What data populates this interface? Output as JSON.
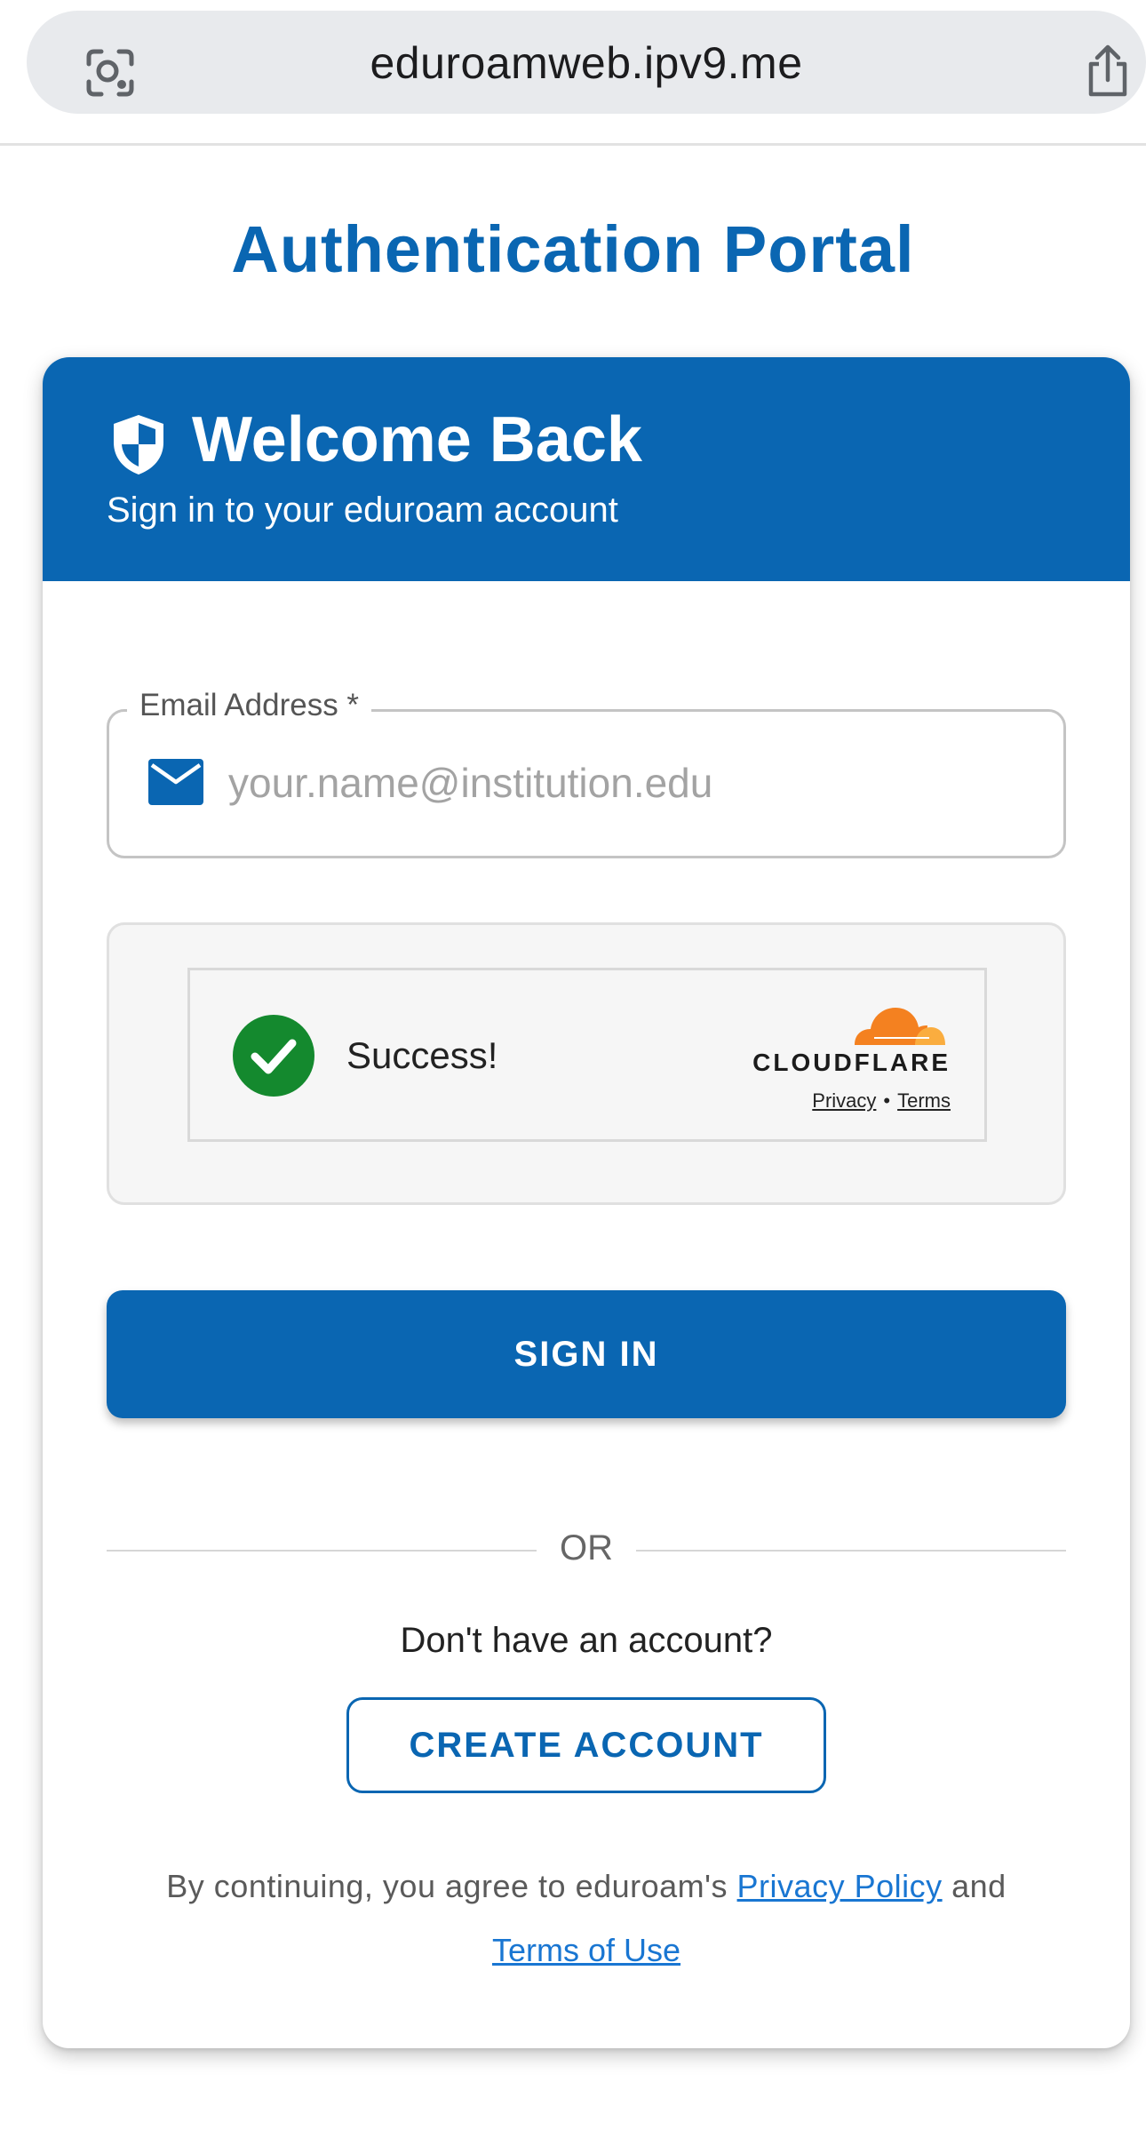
{
  "browser": {
    "url": "eduroamweb.ipv9.me",
    "icons": {
      "left": "visual-search-icon",
      "right": "share-icon"
    }
  },
  "page": {
    "title": "Authentication Portal"
  },
  "card": {
    "header": {
      "title": "Welcome Back",
      "subtitle": "Sign in to your eduroam account",
      "icon": "shield-icon"
    },
    "email": {
      "label": "Email Address *",
      "placeholder": "your.name@institution.edu",
      "value": "",
      "icon": "mail-icon"
    },
    "captcha": {
      "status": "Success!",
      "brand": "CLOUDFLARE",
      "privacy": "Privacy",
      "separator": "•",
      "terms": "Terms",
      "icon": "check-circle-icon"
    },
    "sign_in_label": "SIGN IN",
    "divider_text": "OR",
    "no_account_text": "Don't have an account?",
    "create_account_label": "CREATE ACCOUNT",
    "agreement": {
      "prefix": "By continuing, you agree to eduroam's",
      "privacy_link": "Privacy Policy",
      "conjunction": "and",
      "terms_link": "Terms of Use"
    }
  },
  "colors": {
    "primary": "#0a66b2",
    "link": "#1976d2",
    "success": "#14892e",
    "cloudflare_orange": "#f48120"
  }
}
